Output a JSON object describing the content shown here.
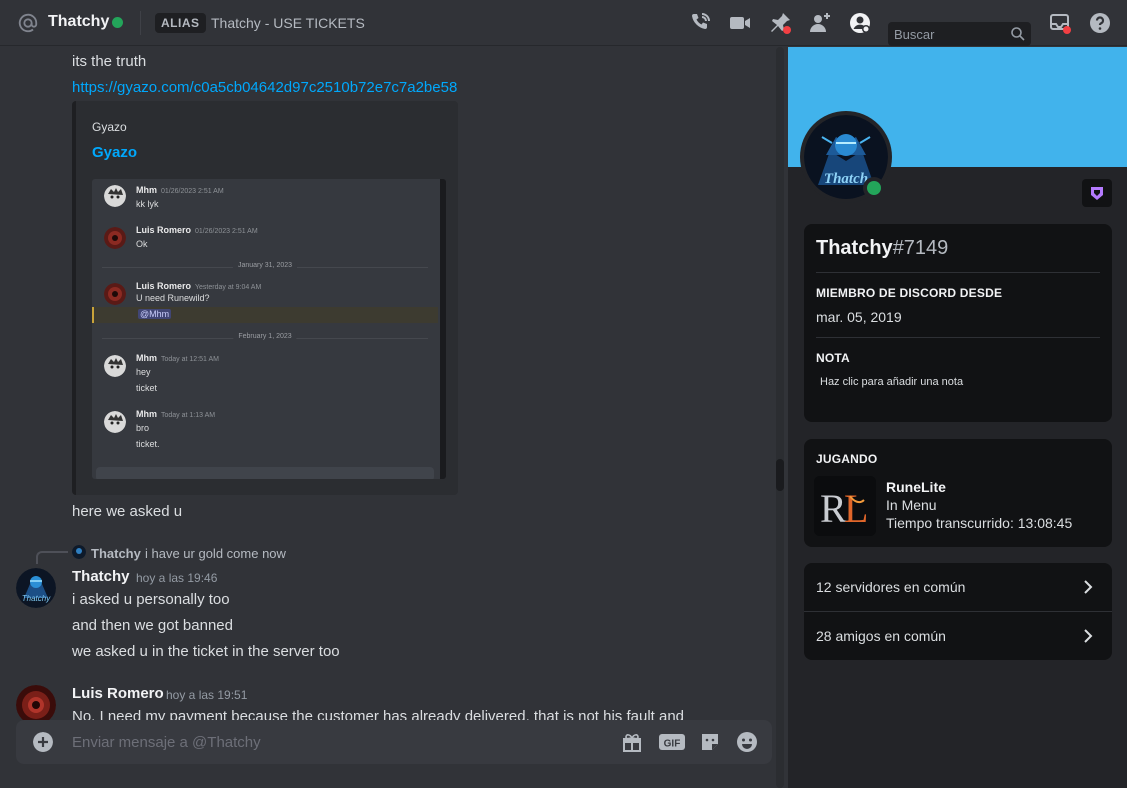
{
  "header": {
    "dm_name": "Thatchy",
    "alias_label": "ALIAS",
    "alias_value": "Thatchy - USE TICKETS",
    "search_placeholder": "Buscar",
    "icons": [
      "at-icon",
      "phone-call-icon",
      "video-icon",
      "pin-icon",
      "add-friend-icon",
      "profile-toggle-icon",
      "search-icon",
      "inbox-icon",
      "help-icon"
    ]
  },
  "chat": {
    "lines_top": [
      "its the truth"
    ],
    "link": "https://gyazo.com/c0a5cb04642d97c2510b72e7c7a2be58",
    "embed": {
      "provider": "Gyazo",
      "title": "Gyazo",
      "screenshot": {
        "messages": [
          {
            "name": "Mhm",
            "time": "01/26/2023 2:51 AM",
            "lines": [
              "kk lyk"
            ]
          },
          {
            "name": "Luis Romero",
            "time": "01/26/2023 2:51 AM",
            "lines": [
              "Ok"
            ]
          },
          {
            "name": "Luis Romero",
            "time": "Yesterday at 9:04 AM",
            "lines": [
              "U need Runewild?"
            ]
          },
          {
            "name": "Mhm",
            "time": "Today at 12:51 AM",
            "lines": [
              "hey",
              "ticket"
            ]
          },
          {
            "name": "Mhm",
            "time": "Today at 1:13 AM",
            "lines": [
              "bro",
              "ticket."
            ]
          }
        ],
        "date1": "January 31, 2023",
        "date2": "February 1, 2023",
        "mention": "@Mhm"
      }
    },
    "after_embed": "here we asked u",
    "reply": {
      "name": "Thatchy",
      "text": "i have ur gold come now"
    },
    "msg1": {
      "author": "Thatchy",
      "time": "hoy a las 19:46",
      "lines": [
        "i asked u personally too",
        "and then we got banned",
        "we asked u in the ticket in the server too"
      ]
    },
    "msg2": {
      "author": "Luis Romero",
      "time": "hoy a las 19:51",
      "lines": [
        "No, I need my payment because the customer has already delivered, that is not his fault and"
      ]
    },
    "composer_placeholder": "Enviar mensaje a @Thatchy"
  },
  "profile": {
    "username": "Thatchy",
    "discriminator": "#7149",
    "member_since_label": "MIEMBRO DE DISCORD DESDE",
    "member_since": "mar. 05, 2019",
    "note_label": "NOTA",
    "note_placeholder": "Haz clic para añadir una nota",
    "playing_label": "JUGANDO",
    "game": {
      "name": "RuneLite",
      "state": "In Menu",
      "elapsed": "Tiempo transcurrido: 13:08:45"
    },
    "mutual_servers": "12 servidores en común",
    "mutual_friends": "28 amigos en común"
  },
  "colors": {
    "accent_link": "#00a8fc",
    "banner": "#41b3ec",
    "online": "#23a55a",
    "background": "#313338"
  }
}
